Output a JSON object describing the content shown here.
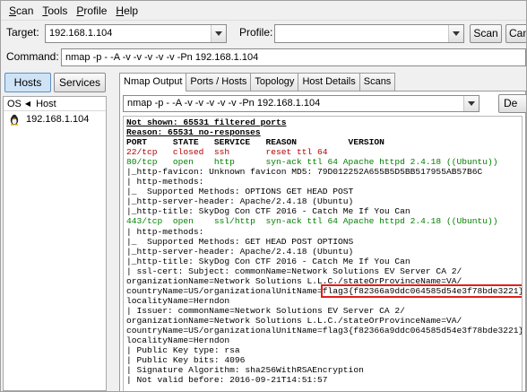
{
  "menu": [
    {
      "u": "S",
      "rest": "can"
    },
    {
      "u": "T",
      "rest": "ools"
    },
    {
      "u": "P",
      "rest": "rofile"
    },
    {
      "u": "H",
      "rest": "elp"
    }
  ],
  "target": {
    "label": "Target:",
    "value": "192.168.1.104"
  },
  "profile": {
    "label": "Profile:",
    "value": ""
  },
  "scan_button": "Scan",
  "cancel_button": "Canc",
  "command": {
    "label": "Command:",
    "value": "nmap -p - -A -v -v -v -v -v -Pn 192.168.1.104"
  },
  "left": {
    "hosts_button": "Hosts",
    "services_button": "Services",
    "col_os": "OS",
    "col_host": "Host",
    "hosts": [
      "192.168.1.104"
    ]
  },
  "tabs": [
    "Nmap Output",
    "Ports / Hosts",
    "Topology",
    "Host Details",
    "Scans"
  ],
  "output_command": "nmap -p - -A -v -v -v -v -v -Pn 192.168.1.104",
  "details_button": "De",
  "output": {
    "not_shown": "Not shown: 65531 filtered ports",
    "reason": "Reason: 65531 no-responses",
    "header": "PORT     STATE   SERVICE   REASON          VERSION",
    "port22": "22/tcp   closed  ssh       reset ttl 64",
    "port80": "80/tcp   open    http      syn-ack ttl 64 Apache httpd 2.4.18 ((Ubuntu))",
    "l80a": "|_http-favicon: Unknown favicon MD5: 79D012252A655B5D5BB517955AB57B6C",
    "l80b": "| http-methods:",
    "l80c": "|_  Supported Methods: OPTIONS GET HEAD POST",
    "l80d": "|_http-server-header: Apache/2.4.18 (Ubuntu)",
    "l80e": "|_http-title: SkyDog Con CTF 2016 - Catch Me If You Can",
    "port443": "443/tcp  open    ssl/http  syn-ack ttl 64 Apache httpd 2.4.18 ((Ubuntu))",
    "l443a": "| http-methods:",
    "l443b": "|_  Supported Methods: GET HEAD POST OPTIONS",
    "l443c": "|_http-server-header: Apache/2.4.18 (Ubuntu)",
    "l443d": "|_http-title: SkyDog Con CTF 2016 - Catch Me If You Can",
    "l443e": "| ssl-cert: Subject: commonName=Network Solutions EV Server CA 2/",
    "l443f": "organizationName=Network Solutions L.L.C./stateOrProvinceName=VA/",
    "l443g_prefix": "countryName=US/organizationalUnitName=",
    "l443g_flag": "flag3{f82366a9ddc064585d54e3f78bde3221}",
    "l443g_suffix": "/",
    "l443h": "localityName=Herndon",
    "l443i": "| Issuer: commonName=Network Solutions EV Server CA 2/",
    "l443j": "organizationName=Network Solutions L.L.C./stateOrProvinceName=VA/",
    "l443k": "countryName=US/organizationalUnitName=flag3{f82366a9ddc064585d54e3f78bde3221}/",
    "l443l": "localityName=Herndon",
    "l443m": "| Public Key type: rsa",
    "l443n": "| Public Key bits: 4096",
    "l443o": "| Signature Algorithm: sha256WithRSAEncryption",
    "l443p": "| Not valid before: 2016-09-21T14:51:57"
  },
  "colors": {
    "closed": "#b00000",
    "open": "#008000",
    "highlight_box": "#e0201c"
  }
}
